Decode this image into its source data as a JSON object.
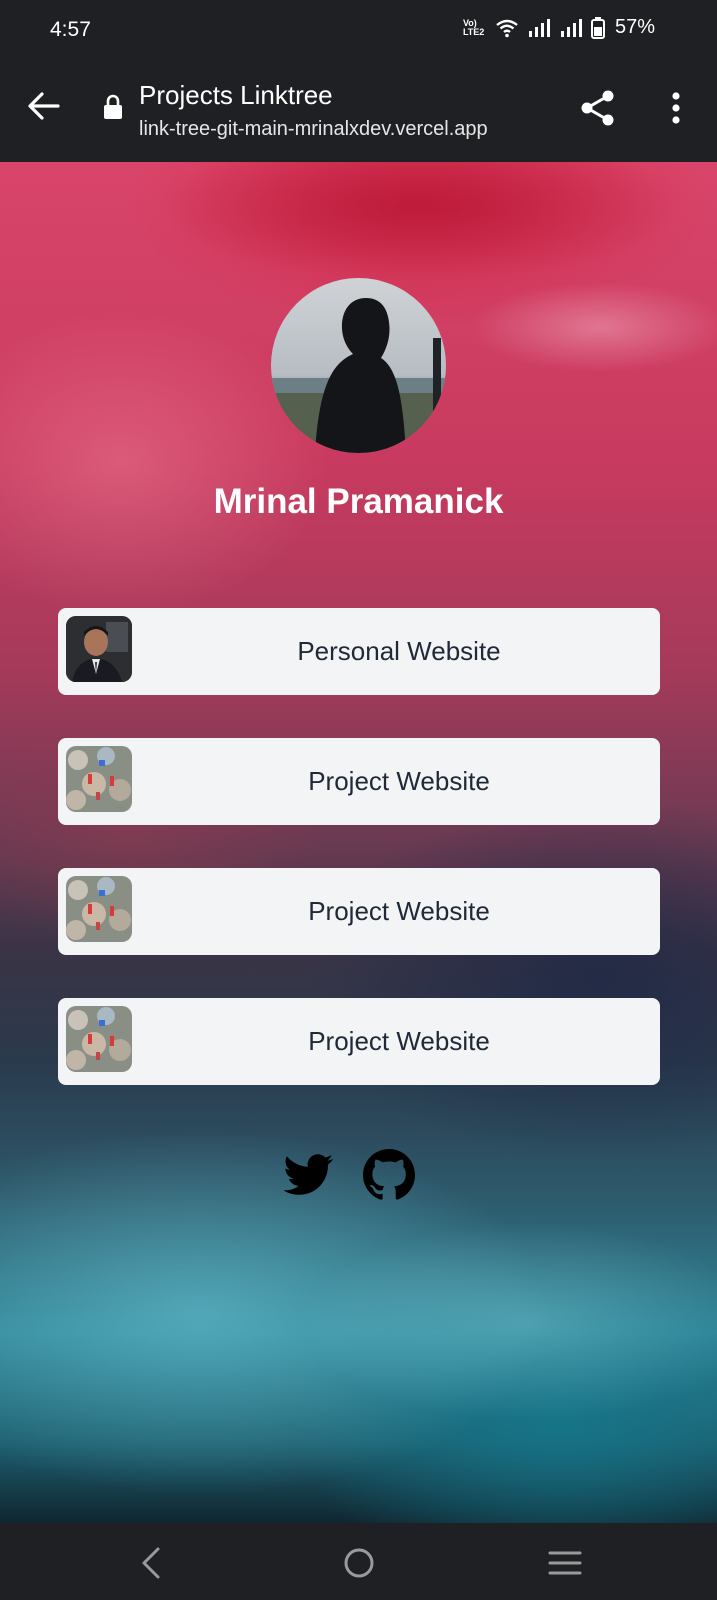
{
  "status_bar": {
    "time": "4:57",
    "network_label": "Vo) LTE2",
    "battery": "57%"
  },
  "browser": {
    "title": "Projects Linktree",
    "url": "link-tree-git-main-mrinalxdev.vercel.app"
  },
  "profile": {
    "name": "Mrinal Pramanick"
  },
  "links": [
    {
      "label": "Personal Website",
      "thumb": "person-photo"
    },
    {
      "label": "Project Website",
      "thumb": "project-photo"
    },
    {
      "label": "Project Website",
      "thumb": "project-photo"
    },
    {
      "label": "Project Website",
      "thumb": "project-photo"
    }
  ],
  "social": [
    {
      "icon": "twitter-icon"
    },
    {
      "icon": "github-icon"
    }
  ],
  "colors": {
    "bar_bg": "#1f2023",
    "card_bg": "#f3f4f6",
    "card_text": "#1f2937"
  }
}
